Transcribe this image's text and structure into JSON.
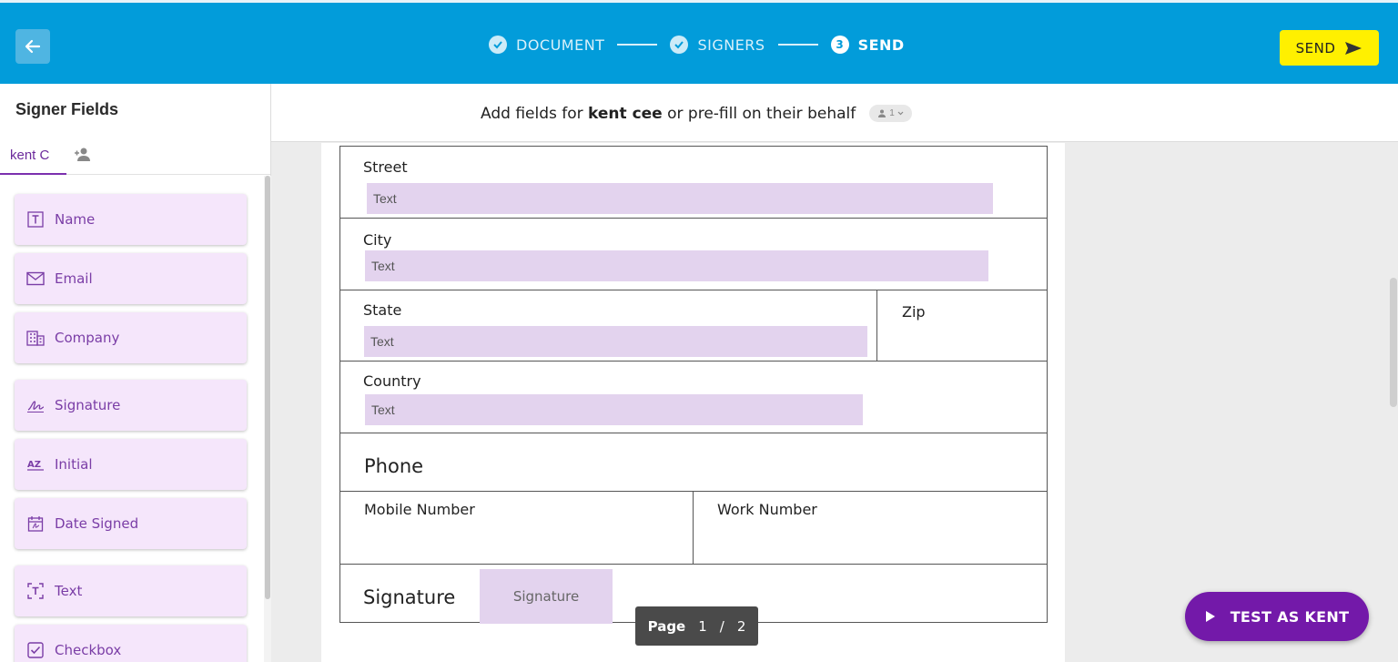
{
  "header": {
    "steps": [
      {
        "label": "DOCUMENT",
        "state": "done"
      },
      {
        "label": "SIGNERS",
        "state": "done"
      },
      {
        "label": "SEND",
        "state": "active",
        "number": "3"
      }
    ],
    "send_label": "SEND",
    "colors": {
      "bar": "#029cda",
      "send_button": "#fff000"
    }
  },
  "sidebar": {
    "title": "Signer Fields",
    "signer_tab": "kent C",
    "fields": [
      {
        "label": "Name",
        "icon": "text-box-icon"
      },
      {
        "label": "Email",
        "icon": "envelope-icon"
      },
      {
        "label": "Company",
        "icon": "building-icon"
      },
      {
        "label": "Signature",
        "icon": "signature-icon"
      },
      {
        "label": "Initial",
        "icon": "az-initial-icon"
      },
      {
        "label": "Date Signed",
        "icon": "calendar-icon"
      },
      {
        "label": "Text",
        "icon": "text-frame-icon"
      },
      {
        "label": "Checkbox",
        "icon": "checkbox-icon"
      }
    ]
  },
  "instruction": {
    "prefix": "Add fields for ",
    "signer_name": "kent cee",
    "suffix": " or pre-fill on their behalf",
    "signer_count": "1"
  },
  "document": {
    "street_label": "Street",
    "street_field": "Text",
    "city_label": "City",
    "city_field": "Text",
    "state_label": "State",
    "state_field": "Text",
    "zip_label": "Zip",
    "country_label": "Country",
    "country_field": "Text",
    "phone_label": "Phone",
    "mobile_label": "Mobile Number",
    "work_label": "Work Number",
    "signature_label": "Signature",
    "signature_field": "Signature"
  },
  "pager": {
    "label": "Page",
    "current": "1",
    "separator": "/",
    "total": "2"
  },
  "test_button": "TEST AS KENT"
}
